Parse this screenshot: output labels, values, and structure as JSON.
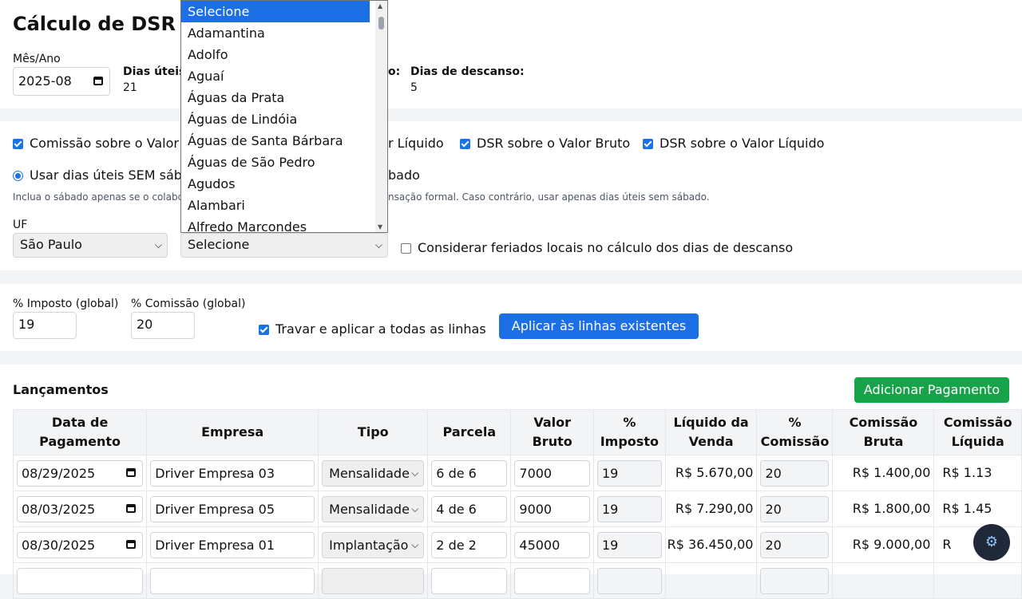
{
  "header": {
    "title": "Cálculo de DSR",
    "month_label": "Mês/Ano",
    "month_value": "2025-08",
    "workdays_label": "Dias úteis",
    "workdays_value": "21",
    "saturday_label_partial": "o:",
    "rest_days_label": "Dias de descanso:",
    "rest_days_value": "5"
  },
  "options": {
    "checkboxes": [
      {
        "label": "Comissão sobre o Valor",
        "checked": true
      },
      {
        "label": "r Líquido",
        "checked": true
      },
      {
        "label": "DSR sobre o Valor Bruto",
        "checked": true
      },
      {
        "label": "DSR sobre o Valor Líquido",
        "checked": true
      }
    ],
    "radio_without_saturday": "Usar dias úteis SEM sáb",
    "radio_with_saturday_partial": "bado",
    "hint_left": "Inclua o sábado apenas se o colabo",
    "hint_right": "nsação formal. Caso contrário, usar apenas dias úteis sem sábado.",
    "uf_label": "UF",
    "uf_value": "São Paulo",
    "city_value": "Selecione",
    "local_holidays_label": "Considerar feriados locais no cálculo dos dias de descanso",
    "local_holidays_checked": false
  },
  "city_dropdown": {
    "items": [
      "Selecione",
      "Adamantina",
      "Adolfo",
      "Aguaí",
      "Águas da Prata",
      "Águas de Lindóia",
      "Águas de Santa Bárbara",
      "Águas de São Pedro",
      "Agudos",
      "Alambari",
      "Alfredo Marcondes"
    ],
    "selected": "Selecione"
  },
  "rates": {
    "tax_label": "% Imposto (global)",
    "tax_value": "19",
    "commission_label": "% Comissão (global)",
    "commission_value": "20",
    "lock_label": "Travar e aplicar a todas as linhas",
    "lock_checked": true,
    "apply_button": "Aplicar às linhas existentes"
  },
  "entries": {
    "title": "Lançamentos",
    "add_button": "Adicionar Pagamento",
    "columns": [
      "Data de Pagamento",
      "Empresa",
      "Tipo",
      "Parcela",
      "Valor Bruto",
      "% Imposto",
      "Líquido da Venda",
      "% Comissão",
      "Comissão Bruta",
      "Comissão Líquida"
    ],
    "rows": [
      {
        "date": "08/29/2025",
        "company": "Driver Empresa 03",
        "type": "Mensalidade",
        "installment": "6 de 6",
        "gross": "7000",
        "tax": "19",
        "net_sale": "R$ 5.670,00",
        "commission_pct": "20",
        "gross_commission": "R$ 1.400,00",
        "net_commission": "R$ 1.13"
      },
      {
        "date": "08/03/2025",
        "company": "Driver Empresa 05",
        "type": "Mensalidade",
        "installment": "4 de 6",
        "gross": "9000",
        "tax": "19",
        "net_sale": "R$ 7.290,00",
        "commission_pct": "20",
        "gross_commission": "R$ 1.800,00",
        "net_commission": "R$ 1.45"
      },
      {
        "date": "08/30/2025",
        "company": "Driver Empresa 01",
        "type": "Implantação",
        "installment": "2 de 2",
        "gross": "45000",
        "tax": "19",
        "net_sale": "R$ 36.450,00",
        "commission_pct": "20",
        "gross_commission": "R$ 9.000,00",
        "net_commission": "R"
      }
    ]
  },
  "fab": {
    "icon": "gear-icon"
  }
}
